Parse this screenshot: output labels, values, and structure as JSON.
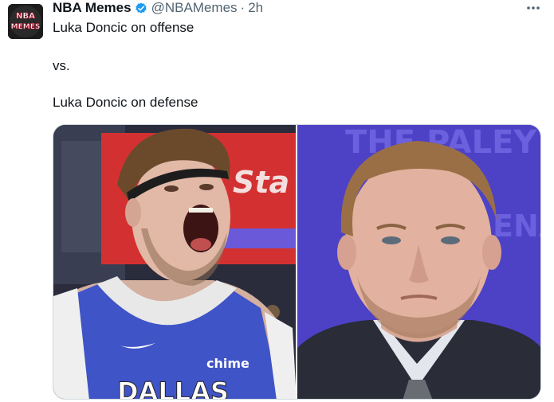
{
  "account": {
    "display_name": "NBA Memes",
    "handle": "@NBAMemes",
    "separator": "·",
    "time": "2h",
    "avatar_lines": [
      "NBA",
      "MEMES"
    ],
    "verified_color": "#1d9bf0"
  },
  "tweet": {
    "lines": [
      "Luka Doncic on offense",
      "vs.",
      "Luka Doncic on defense"
    ]
  },
  "media": {
    "left": {
      "sign_text": "Sta",
      "jersey_sponsor": "chime",
      "jersey_team": "DALLAS"
    },
    "right": {
      "backdrop_text": "THE PALEY",
      "backdrop_text_2": "ENA"
    }
  },
  "icons": {
    "more": "more-options-icon",
    "verified": "verified-badge-icon"
  }
}
